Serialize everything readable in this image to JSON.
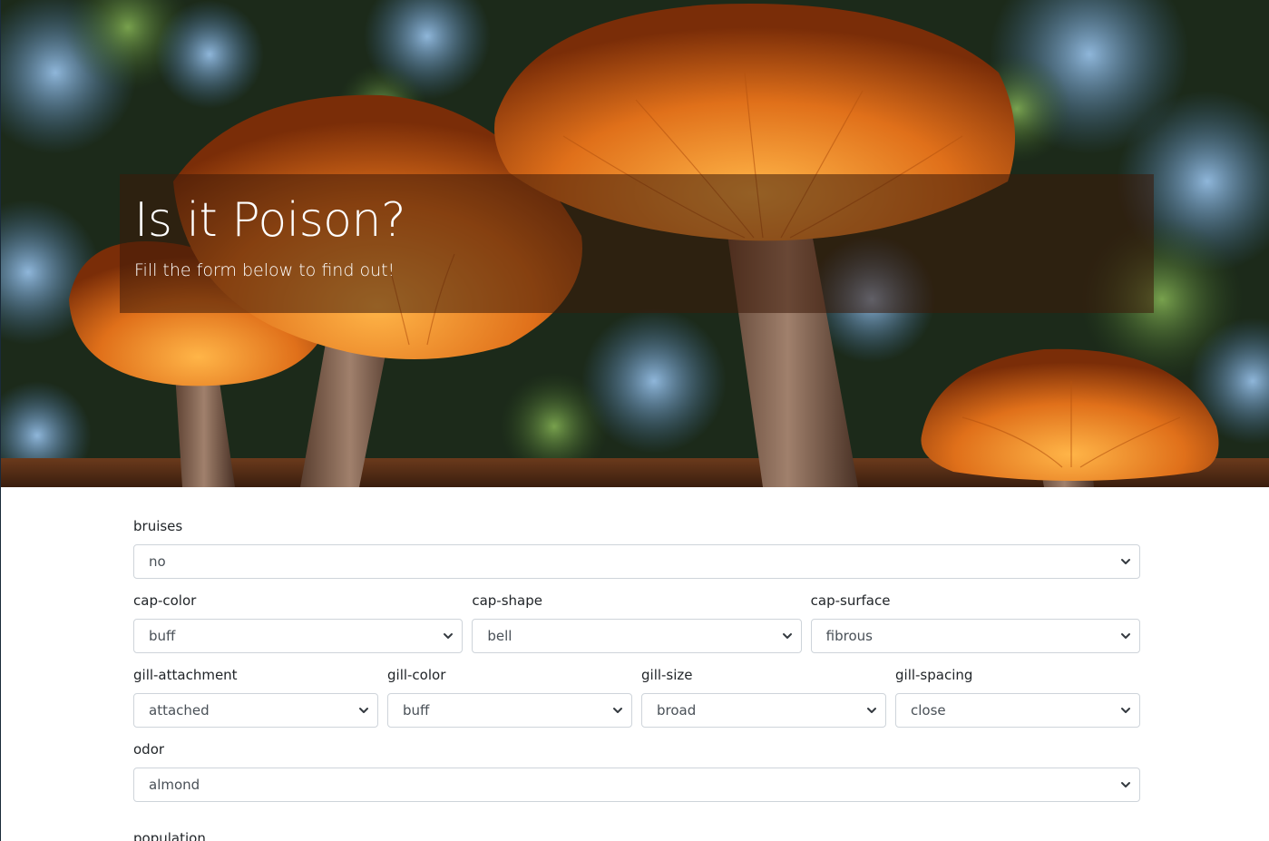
{
  "hero": {
    "title": "Is it Poison?",
    "subtitle": "Fill the form below to find out!"
  },
  "form": {
    "bruises": {
      "label": "bruises",
      "value": "no"
    },
    "cap_color": {
      "label": "cap-color",
      "value": "buff"
    },
    "cap_shape": {
      "label": "cap-shape",
      "value": "bell"
    },
    "cap_surface": {
      "label": "cap-surface",
      "value": "fibrous"
    },
    "gill_attachment": {
      "label": "gill-attachment",
      "value": "attached"
    },
    "gill_color": {
      "label": "gill-color",
      "value": "buff"
    },
    "gill_size": {
      "label": "gill-size",
      "value": "broad"
    },
    "gill_spacing": {
      "label": "gill-spacing",
      "value": "close"
    },
    "odor": {
      "label": "odor",
      "value": "almond"
    },
    "population": {
      "label": "population"
    }
  },
  "colors": {
    "accent_orange": "#e07a1c",
    "select_border": "#ced4da",
    "text": "#212529"
  },
  "icons": {
    "select_arrow": "chevron-down-icon"
  }
}
